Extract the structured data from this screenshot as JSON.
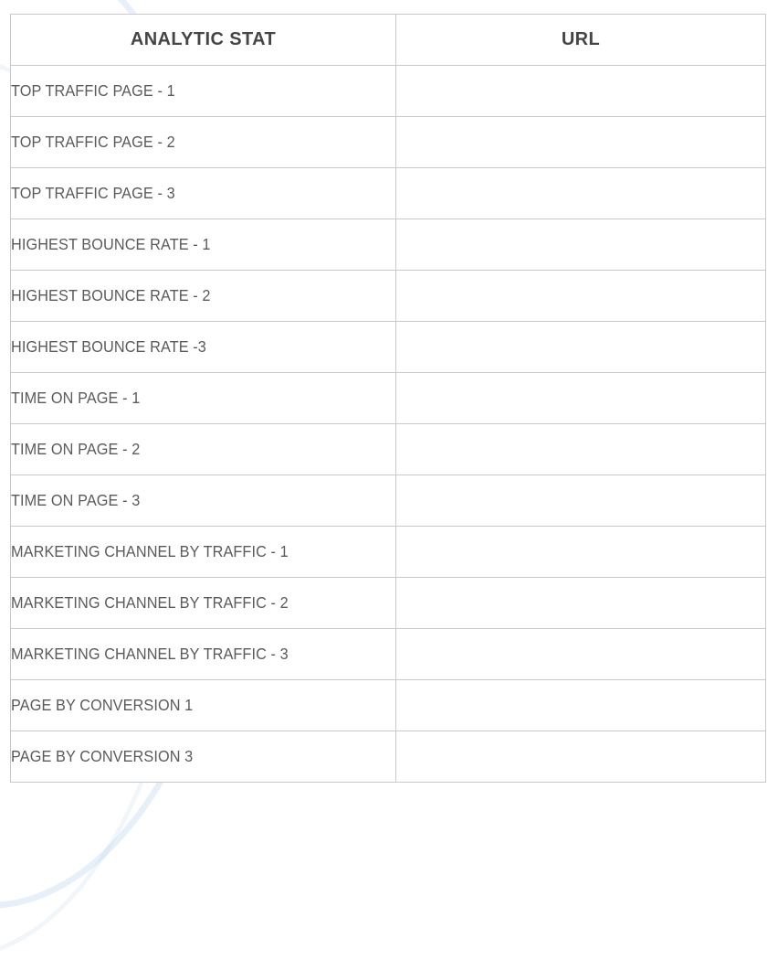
{
  "document": {
    "type": "worksheet-table",
    "border_color": "#c9c9c9",
    "header_text_color": "#454545",
    "body_text_color": "#5a5a5a",
    "background_color": "#ffffff"
  },
  "table": {
    "columns": [
      {
        "key": "stat",
        "label": "ANALYTIC STAT"
      },
      {
        "key": "url",
        "label": "URL"
      }
    ],
    "rows": [
      {
        "stat": "TOP TRAFFIC PAGE - 1",
        "url": ""
      },
      {
        "stat": "TOP TRAFFIC PAGE - 2",
        "url": ""
      },
      {
        "stat": "TOP TRAFFIC PAGE - 3",
        "url": ""
      },
      {
        "stat": "HIGHEST BOUNCE RATE - 1",
        "url": ""
      },
      {
        "stat": "HIGHEST BOUNCE RATE - 2",
        "url": ""
      },
      {
        "stat": "HIGHEST BOUNCE RATE -3",
        "url": ""
      },
      {
        "stat": "TIME ON PAGE - 1",
        "url": ""
      },
      {
        "stat": "TIME ON PAGE - 2",
        "url": ""
      },
      {
        "stat": "TIME ON PAGE - 3",
        "url": ""
      },
      {
        "stat": "MARKETING CHANNEL BY TRAFFIC - 1",
        "url": ""
      },
      {
        "stat": "MARKETING CHANNEL BY TRAFFIC - 2",
        "url": ""
      },
      {
        "stat": "MARKETING CHANNEL BY TRAFFIC - 3",
        "url": ""
      },
      {
        "stat": "PAGE BY CONVERSION 1",
        "url": ""
      },
      {
        "stat": "PAGE BY CONVERSION 3",
        "url": ""
      }
    ]
  }
}
